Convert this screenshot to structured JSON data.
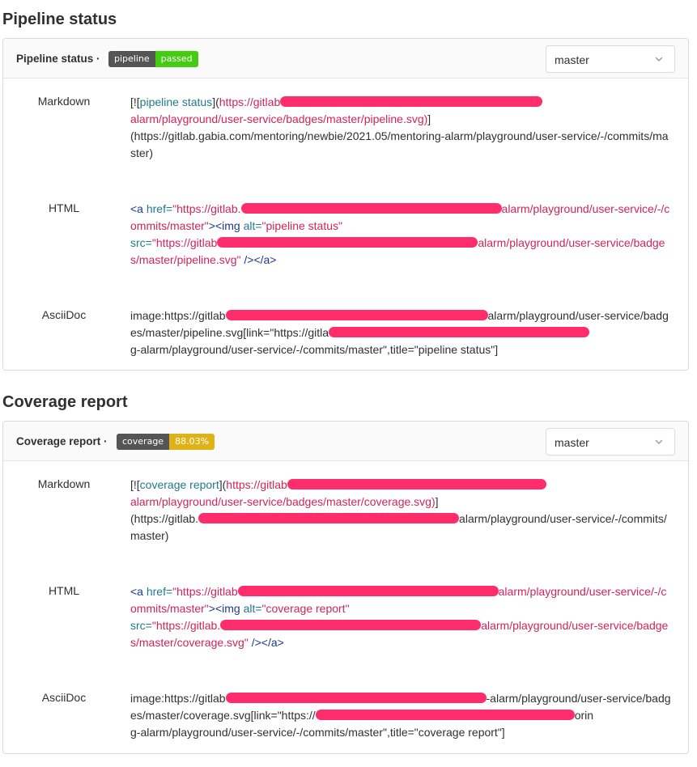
{
  "colors": {
    "badge_label_bg": "#555555",
    "passed": "#4c1",
    "coverage": "#dfb317",
    "redaction": "#ff2d6b",
    "markdown_url": "#d0245a",
    "markdown_alt": "#1f7a8c",
    "html_tag": "#1c3a8c"
  },
  "pipeline": {
    "section_title": "Pipeline status",
    "header_title": "Pipeline status ·",
    "badge_label": "pipeline",
    "badge_value": "passed",
    "branch": "master",
    "rows": {
      "markdown": {
        "label": "Markdown",
        "p1": "[![",
        "alt": "pipeline status",
        "p2": "](",
        "url_start": "https://gitlab",
        "url_end": "alarm/playground/user-service/badges/master/pipeline.svg)",
        "p3": "]",
        "link": "(https://gitlab.gabia.com/mentoring/newbie/2021.05/mentoring-alarm/playground/user-service/-/commits/master)"
      },
      "html": {
        "label": "HTML",
        "tag_open": "<a ",
        "href_attr": "href=",
        "href_start": "\"https://gitlab.",
        "href_end": "alarm/playground/user-service/-/commits/master\"",
        "img_open": "><img ",
        "alt_attr": "alt=",
        "alt_val": "\"pipeline status\"",
        "src_attr": "src=",
        "src_start": "\"https://gitlab",
        "src_end": "alarm/playground/user-service/badges/master/pipeline.svg\"",
        "tag_close": " /></a>"
      },
      "asciidoc": {
        "label": "AsciiDoc",
        "part1": "image:https://gitlab",
        "part2": "alarm/playground/user-service/badges/master/pipeline.svg[link=\"https://gitla",
        "part3": "g-alarm/playground/user-service/-/commits/master\",title=\"pipeline status\"]"
      }
    }
  },
  "coverage": {
    "section_title": "Coverage report",
    "header_title": "Coverage report ·",
    "badge_label": "coverage",
    "badge_value": "88.03%",
    "branch": "master",
    "rows": {
      "markdown": {
        "label": "Markdown",
        "p1": "[![",
        "alt": "coverage report",
        "p2": "](",
        "url_start": "https://gitlab",
        "url_end": "alarm/playground/user-service/badges/master/coverage.svg)",
        "p3": "]",
        "link_start": "(https://gitlab.",
        "link_end": "alarm/playground/user-service/-/commits/master)"
      },
      "html": {
        "label": "HTML",
        "tag_open": "<a ",
        "href_attr": "href=",
        "href_start": "\"https://gitlab",
        "href_end": "alarm/playground/user-service/-/commits/master\"",
        "img_open": "><img ",
        "alt_attr": "alt=",
        "alt_val": "\"coverage report\"",
        "src_attr": "src=",
        "src_start": "\"https://gitlab.",
        "src_end": "alarm/playground/user-service/badges/master/coverage.svg\"",
        "tag_close": " /></a>"
      },
      "asciidoc": {
        "label": "AsciiDoc",
        "part1": "image:https://gitlab",
        "part2": "-alarm/playground/user-service/badges/master/coverage.svg[link=\"https://",
        "part3": "orin",
        "part4": "g-alarm/playground/user-service/-/commits/master\",title=\"coverage report\"]"
      }
    }
  }
}
